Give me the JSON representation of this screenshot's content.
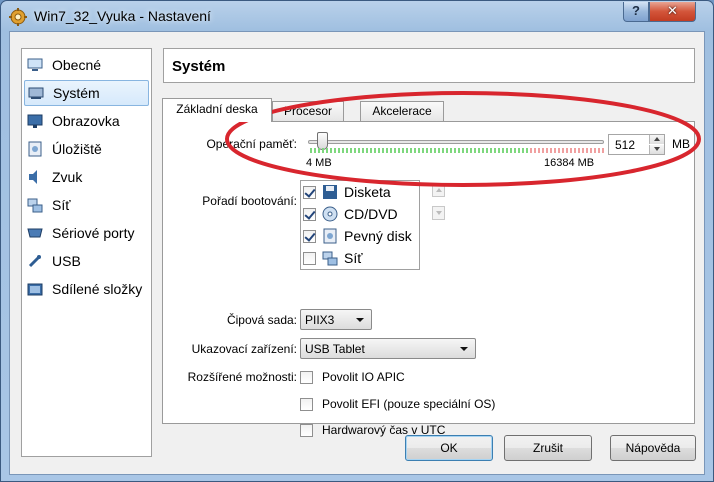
{
  "window": {
    "title": "Win7_32_Vyuka - Nastavení",
    "help_glyph": "?",
    "close_glyph": "✕"
  },
  "sidebar": {
    "items": [
      {
        "label": "Obecné",
        "icon": "monitor-icon"
      },
      {
        "label": "Systém",
        "icon": "chip-icon",
        "selected": true
      },
      {
        "label": "Obrazovka",
        "icon": "display-icon"
      },
      {
        "label": "Úložiště",
        "icon": "storage-icon"
      },
      {
        "label": "Zvuk",
        "icon": "speaker-icon"
      },
      {
        "label": "Síť",
        "icon": "network-icon"
      },
      {
        "label": "Sériové porty",
        "icon": "serial-port-icon"
      },
      {
        "label": "USB",
        "icon": "usb-icon"
      },
      {
        "label": "Sdílené složky",
        "icon": "shared-folder-icon"
      }
    ]
  },
  "header": {
    "title": "Systém"
  },
  "tabs": [
    {
      "label": "Základní deska",
      "active": true
    },
    {
      "label": "Procesor"
    },
    {
      "label": "Akcelerace"
    }
  ],
  "memory": {
    "label": "Operační paměť:",
    "value": "512",
    "unit": "MB",
    "min_label": "4 MB",
    "max_label": "16384 MB",
    "level_fraction": 0.031
  },
  "boot": {
    "label": "Pořadí bootování:",
    "items": [
      {
        "label": "Disketa",
        "checked": true,
        "icon": "floppy-icon"
      },
      {
        "label": "CD/DVD",
        "checked": true,
        "icon": "cd-dvd-icon"
      },
      {
        "label": "Pevný disk",
        "checked": true,
        "icon": "hard-disk-icon"
      },
      {
        "label": "Síť",
        "checked": false,
        "icon": "network-boot-icon"
      }
    ]
  },
  "chipset": {
    "label": "Čipová sada:",
    "value": "PIIX3"
  },
  "pointing": {
    "label": "Ukazovací zařízení:",
    "value": "USB Tablet"
  },
  "extended": {
    "label": "Rozšířené možnosti:",
    "options": [
      {
        "label": "Povolit IO APIC",
        "checked": false
      },
      {
        "label": "Povolit EFI (pouze speciální OS)",
        "checked": false
      },
      {
        "label": "Hardwarový čas v UTC",
        "checked": false
      }
    ]
  },
  "buttons": {
    "ok": "OK",
    "cancel": "Zrušit",
    "help": "Nápověda"
  },
  "colors": {
    "annotation_ellipse": "#d8262e",
    "selection": "#d6e9fb",
    "slider_green": "#7ed87e",
    "slider_red": "#f0a0a0"
  }
}
